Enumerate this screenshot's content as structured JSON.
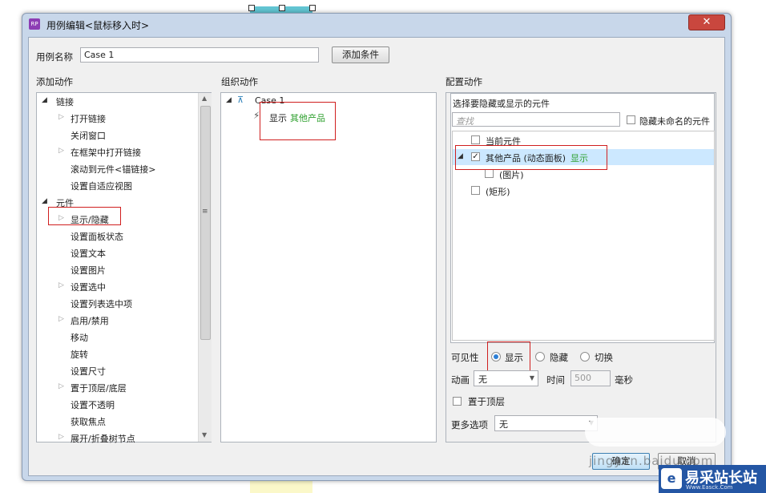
{
  "dialog": {
    "app_icon_text": "RP",
    "title": "用例编辑<鼠标移入时>",
    "close_glyph": "✕"
  },
  "case_name": {
    "label": "用例名称",
    "value": "Case 1",
    "add_condition_button": "添加条件"
  },
  "add_action": {
    "header": "添加动作",
    "groups": [
      {
        "label": "链接",
        "items": [
          {
            "label": "打开链接",
            "expandable": true
          },
          {
            "label": "关闭窗口",
            "expandable": false
          },
          {
            "label": "在框架中打开链接",
            "expandable": true
          },
          {
            "label": "滚动到元件<锚链接>",
            "expandable": false
          },
          {
            "label": "设置自适应视图",
            "expandable": false
          }
        ]
      },
      {
        "label": "元件",
        "items": [
          {
            "label": "显示/隐藏",
            "expandable": true
          },
          {
            "label": "设置面板状态",
            "expandable": false
          },
          {
            "label": "设置文本",
            "expandable": false
          },
          {
            "label": "设置图片",
            "expandable": false
          },
          {
            "label": "设置选中",
            "expandable": true
          },
          {
            "label": "设置列表选中项",
            "expandable": false
          },
          {
            "label": "启用/禁用",
            "expandable": true
          },
          {
            "label": "移动",
            "expandable": false
          },
          {
            "label": "旋转",
            "expandable": false
          },
          {
            "label": "设置尺寸",
            "expandable": false
          },
          {
            "label": "置于顶层/底层",
            "expandable": true
          },
          {
            "label": "设置不透明",
            "expandable": false
          },
          {
            "label": "获取焦点",
            "expandable": false
          },
          {
            "label": "展开/折叠树节点",
            "expandable": true
          }
        ]
      }
    ]
  },
  "organize_action": {
    "header": "组织动作",
    "case_label": "Case 1",
    "action_verb": "显示",
    "action_target": "其他产品"
  },
  "configure_action": {
    "header": "配置动作",
    "prompt": "选择要隐藏或显示的元件",
    "search_placeholder": "查找",
    "hide_unnamed_label": "隐藏未命名的元件",
    "widgets": {
      "current": "当前元件",
      "dynamic_panel": "其他产品 (动态面板)",
      "dynamic_panel_state": "显示",
      "image": "(图片)",
      "rectangle": "(矩形)"
    },
    "visibility_label": "可见性",
    "visibility_options": [
      "显示",
      "隐藏",
      "切换"
    ],
    "visibility_selected": "显示",
    "animation_label": "动画",
    "animation_value": "无",
    "time_label": "时间",
    "time_value": "500",
    "time_unit": "毫秒",
    "bring_to_front_label": "置于顶层",
    "more_options_label": "更多选项",
    "more_options_value": "无"
  },
  "footer": {
    "ok_button": "确定",
    "cancel_button": "取消"
  },
  "watermarks": {
    "baidu_text": "jingyan.baidu.com",
    "site_name": "易采站长站",
    "site_url": "Www.Easck.Com"
  },
  "colors": {
    "highlight_red": "#d01f1f",
    "green_state": "#2ea02e",
    "selected_row": "#cce8ff",
    "title_bar": "#c8d7ea"
  }
}
